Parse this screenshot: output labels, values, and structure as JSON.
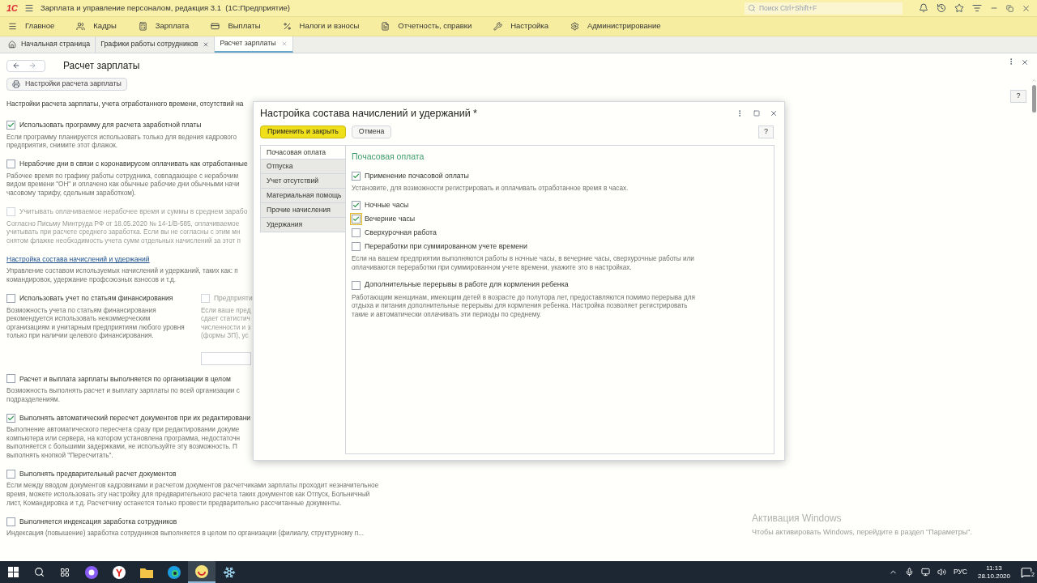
{
  "window": {
    "logo": "1С",
    "title": "Зарплата и управление персоналом, редакция 3.1  (1С:Предприятие)",
    "search_placeholder": "Поиск Ctrl+Shift+F"
  },
  "menu": [
    {
      "label": "Главное",
      "kind": "menu"
    },
    {
      "label": "Кадры",
      "kind": "people"
    },
    {
      "label": "Зарплата",
      "kind": "calc"
    },
    {
      "label": "Выплаты",
      "kind": "card"
    },
    {
      "label": "Налоги и взносы",
      "kind": "percent"
    },
    {
      "label": "Отчетность, справки",
      "kind": "report"
    },
    {
      "label": "Настройка",
      "kind": "wrench"
    },
    {
      "label": "Администрирование",
      "kind": "gear"
    }
  ],
  "tabs": [
    {
      "label": "Начальная страница",
      "selected": false,
      "closable": false
    },
    {
      "label": "Графики работы сотрудников",
      "selected": false,
      "closable": true
    },
    {
      "label": "Расчет зарплаты",
      "selected": true,
      "closable": true
    }
  ],
  "page": {
    "title": "Расчет зарплаты",
    "settings_button": "Настройки расчета зарплаты",
    "help": "?",
    "intro": "Настройки расчета зарплаты, учета отработанного времени, отсутствий на",
    "options": [
      {
        "kind": "checkbox",
        "label": "Использовать программу для расчета заработной платы",
        "checked": true,
        "disabled": false,
        "description": [
          "Если программу планируется использовать только для ведения кадрового",
          "предприятия, снимите этот флажок."
        ]
      },
      {
        "kind": "checkbox",
        "label": "Нерабочие дни в связи с коронавирусом оплачивать как отработанные",
        "checked": false,
        "disabled": false,
        "description": [
          "Рабочее время по графику работы сотрудника, совпадающее с нерабочим",
          "видом времени \"ОН\" и оплачено как обычные рабочие дни обычными начи",
          "часовому тарифу, сдельным заработком)."
        ]
      },
      {
        "kind": "checkbox",
        "label": "Учитывать оплачиваемое нерабочее время и суммы в среднем зарабо",
        "checked": false,
        "disabled": true,
        "description": [
          "Согласно Письму Минтруда РФ от 18.05.2020 № 14-1/В-585, оплачиваемое",
          "учитывать при расчете среднего заработка. Если вы не согласны с этим мн",
          "снятом флажке необходимость учета сумм отдельных начислений за этот п"
        ]
      },
      {
        "kind": "link",
        "label": "Настройка состава начислений и удержаний",
        "description": [
          "Управление составом используемых начислений и удержаний, таких как: п",
          "командировок, удержание профсоюзных взносов и т.д."
        ]
      },
      {
        "kind": "pair",
        "columns": [
          {
            "label": "Использовать учет по статьям финансирования",
            "checked": false,
            "disabled": false,
            "field": false,
            "description": [
              "Возможность учета по статьям финансирования",
              "рекомендуется использовать некоммерческим",
              "организациям и унитарным предприятиям любого уровня",
              "только при наличии целевого финансирования."
            ]
          },
          {
            "label": "Предприяти",
            "checked": false,
            "disabled": true,
            "field": true,
            "description": [
              "Если ваше пред",
              "сдает статистич",
              "численности и з",
              "(формы ЗП), ус"
            ]
          }
        ]
      },
      {
        "kind": "checkbox",
        "label": "Расчет и выплата зарплаты выполняется по организации в целом",
        "checked": false,
        "disabled": false,
        "description": [
          "Возможность выполнять расчет и выплату зарплаты по всей организации с",
          "подразделениям."
        ]
      },
      {
        "kind": "checkbox",
        "label": "Выполнять автоматический пересчет документов при их редактировани",
        "checked": true,
        "disabled": false,
        "description": [
          "Выполнение автоматического пересчета сразу при редактировании докуме",
          "компьютера или сервера, на котором установлена программа, недостаточн",
          "выполняется с большими задержками, не используйте эту возможность. П",
          "выполнять кнопкой \"Пересчитать\"."
        ]
      },
      {
        "kind": "checkbox",
        "label": "Выполнять предварительный расчет документов",
        "checked": false,
        "disabled": false,
        "description": [
          "Если между вводом документов кадровиками и расчетом документов расчетчиками зарплаты проходит незначительное",
          "время, можете использовать эту настройку для предварительного расчета таких документов как Отпуск, Больничный",
          "лист, Командировка и т.д. Расчетчику останется только провести предварительно рассчитанные документы."
        ]
      },
      {
        "kind": "checkbox",
        "label": "Выполняется индексация заработка сотрудников",
        "checked": false,
        "disabled": false,
        "description": [
          "Индексация (повышение) заработка сотрудников выполняется в целом по организации (филиалу, структурному п..."
        ]
      }
    ]
  },
  "dialog": {
    "title": "Настройка состава начислений и удержаний *",
    "help": "?",
    "buttons": [
      {
        "label": "Применить и закрыть",
        "default": true
      },
      {
        "label": "Отмена",
        "default": false
      }
    ],
    "sections": [
      {
        "label": "Почасовая оплата",
        "selected": true
      },
      {
        "label": "Отпуска",
        "selected": false
      },
      {
        "label": "Учет отсутствий",
        "selected": false
      },
      {
        "label": "Материальная помощь",
        "selected": false
      },
      {
        "label": "Прочие начисления",
        "selected": false
      },
      {
        "label": "Удержания",
        "selected": false
      }
    ],
    "heading": "Почасовая оплата",
    "options": [
      {
        "label": "Применение почасовой оплаты",
        "checked": true,
        "focused": false,
        "description": [
          "Установите, для возможности регистрировать и оплачивать отработанное время в часах."
        ]
      },
      {
        "label": "Ночные часы",
        "checked": true,
        "focused": false
      },
      {
        "label": "Вечерние часы",
        "checked": true,
        "focused": true
      },
      {
        "label": "Сверхурочная работа",
        "checked": false,
        "focused": false
      },
      {
        "label": "Переработки при суммированном учете времени",
        "checked": false,
        "focused": false,
        "description": [
          "Если на вашем предприятии выполняются работы в ночные часы, в вечерние часы, сверхурочные работы или",
          "оплачиваются переработки при суммированном учете времени, укажите это в настройках."
        ]
      },
      {
        "label": "Дополнительные перерывы в работе для кормления ребенка",
        "checked": false,
        "focused": false,
        "description": [
          "Работающим женщинам, имеющим детей в возрасте до полутора лет, предоставляются помимо перерыва для",
          "отдыха и питания дополнительные перерывы для кормления ребенка. Настройка позволяет регистрировать",
          "такие и автоматически оплачивать эти периоды по среднему."
        ]
      }
    ]
  },
  "activation": {
    "title": "Активация Windows",
    "text": "Чтобы активировать Windows, перейдите в раздел \"Параметры\"."
  },
  "taskbar": {
    "apps": [
      {
        "kind": "alice",
        "active": false
      },
      {
        "kind": "yandex",
        "active": false
      },
      {
        "kind": "folder",
        "active": false
      },
      {
        "kind": "edge",
        "active": false
      },
      {
        "kind": "onec",
        "active": true
      },
      {
        "kind": "snow",
        "active": false
      }
    ],
    "language": "РУС",
    "time": "11:13",
    "date": "28.10.2020",
    "notifications": "2"
  }
}
